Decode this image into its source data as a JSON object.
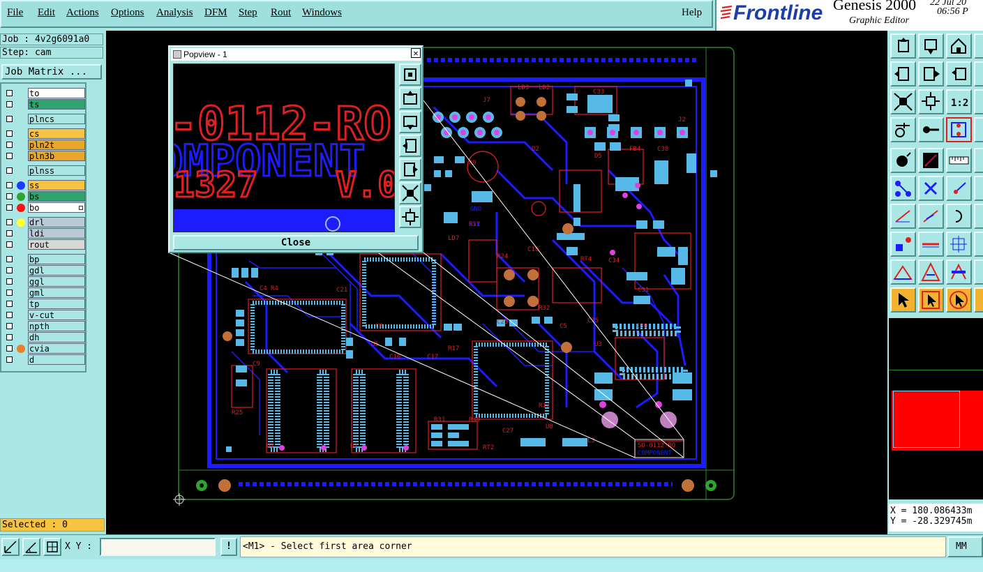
{
  "menu": [
    {
      "label": "File"
    },
    {
      "label": "Edit"
    },
    {
      "label": "Actions"
    },
    {
      "label": "Options"
    },
    {
      "label": "Analysis"
    },
    {
      "label": "DFM"
    },
    {
      "label": "Step"
    },
    {
      "label": "Rout"
    },
    {
      "label": "Windows"
    }
  ],
  "help_label": "Help",
  "brand": {
    "logo": "Frontline",
    "app": "Genesis 2000",
    "subtitle": "Graphic Editor",
    "date": "22 Jul 20",
    "time": "06:56 P"
  },
  "job": {
    "job_line": "Job : 4v2g6091a0",
    "step_line": "Step: cam",
    "matrix_button": "Job Matrix ..."
  },
  "layers": [
    {
      "name": "to",
      "color": "#ffffff",
      "dot": "",
      "group": 1
    },
    {
      "name": "ts",
      "color": "#2fa46e",
      "dot": "",
      "group": 1
    },
    {
      "name": "plncs",
      "color": "#a9e6e4",
      "dot": "",
      "group": 2
    },
    {
      "name": "cs",
      "color": "#f7c341",
      "dot": "",
      "group": 3
    },
    {
      "name": "pln2t",
      "color": "#e8a72a",
      "dot": "",
      "group": 3
    },
    {
      "name": "pln3b",
      "color": "#e8a72a",
      "dot": "",
      "group": 3
    },
    {
      "name": "plnss",
      "color": "#a9e6e4",
      "dot": "",
      "group": 4
    },
    {
      "name": "ss",
      "color": "#f7c341",
      "dot": "#1c3bff",
      "group": 5
    },
    {
      "name": "bs",
      "color": "#2fa46e",
      "dot": "#2fa42f",
      "group": 5
    },
    {
      "name": "bo",
      "color": "#ffffff",
      "dot": "#ff1010",
      "group": 5
    },
    {
      "name": "drl",
      "color": "#b9c9d6",
      "dot": "#ffff30",
      "group": 6
    },
    {
      "name": "ldi",
      "color": "#b9c9d6",
      "dot": "",
      "group": 6
    },
    {
      "name": "rout",
      "color": "#d8d8d8",
      "dot": "",
      "group": 6
    },
    {
      "name": "bp",
      "color": "#a9e6e4",
      "dot": "",
      "group": 7
    },
    {
      "name": "gdl",
      "color": "#a9e6e4",
      "dot": "",
      "group": 7
    },
    {
      "name": "ggl",
      "color": "#a9e6e4",
      "dot": "",
      "group": 7
    },
    {
      "name": "gml",
      "color": "#a9e6e4",
      "dot": "",
      "group": 7
    },
    {
      "name": "tp",
      "color": "#a9e6e4",
      "dot": "",
      "group": 7
    },
    {
      "name": "v-cut",
      "color": "#a9e6e4",
      "dot": "",
      "group": 7
    },
    {
      "name": "npth",
      "color": "#a9e6e4",
      "dot": "",
      "group": 7
    },
    {
      "name": "dh",
      "color": "#a9e6e4",
      "dot": "",
      "group": 7
    },
    {
      "name": "cvia",
      "color": "#a9e6e4",
      "dot": "#e8822a",
      "group": 7
    },
    {
      "name": "d",
      "color": "#a9e6e4",
      "dot": "",
      "group": 7
    }
  ],
  "selected_label": "Selected : 0",
  "popview": {
    "title": "Popview - 1",
    "close_label": "Close",
    "preview_text_line1": "-0112-RO",
    "preview_text_line2": "OMPONENT",
    "preview_text_line3": "1327",
    "preview_text_line4": "V.0"
  },
  "board_texts": [
    "SO-0112-RO",
    "COMPONENT"
  ],
  "coords": {
    "x_label": "X = 180.086433m",
    "y_label": "Y = -28.329745m"
  },
  "bottom": {
    "xy_label": "X Y :",
    "xy_value": "",
    "excl": "!",
    "prompt": "<M1> - Select first area corner",
    "units": "MM"
  },
  "colors": {
    "panel": "#a9e6e4",
    "board_blue": "#1c1cff",
    "pad_cyan": "#57b9e8",
    "silk_red": "#e02020"
  }
}
